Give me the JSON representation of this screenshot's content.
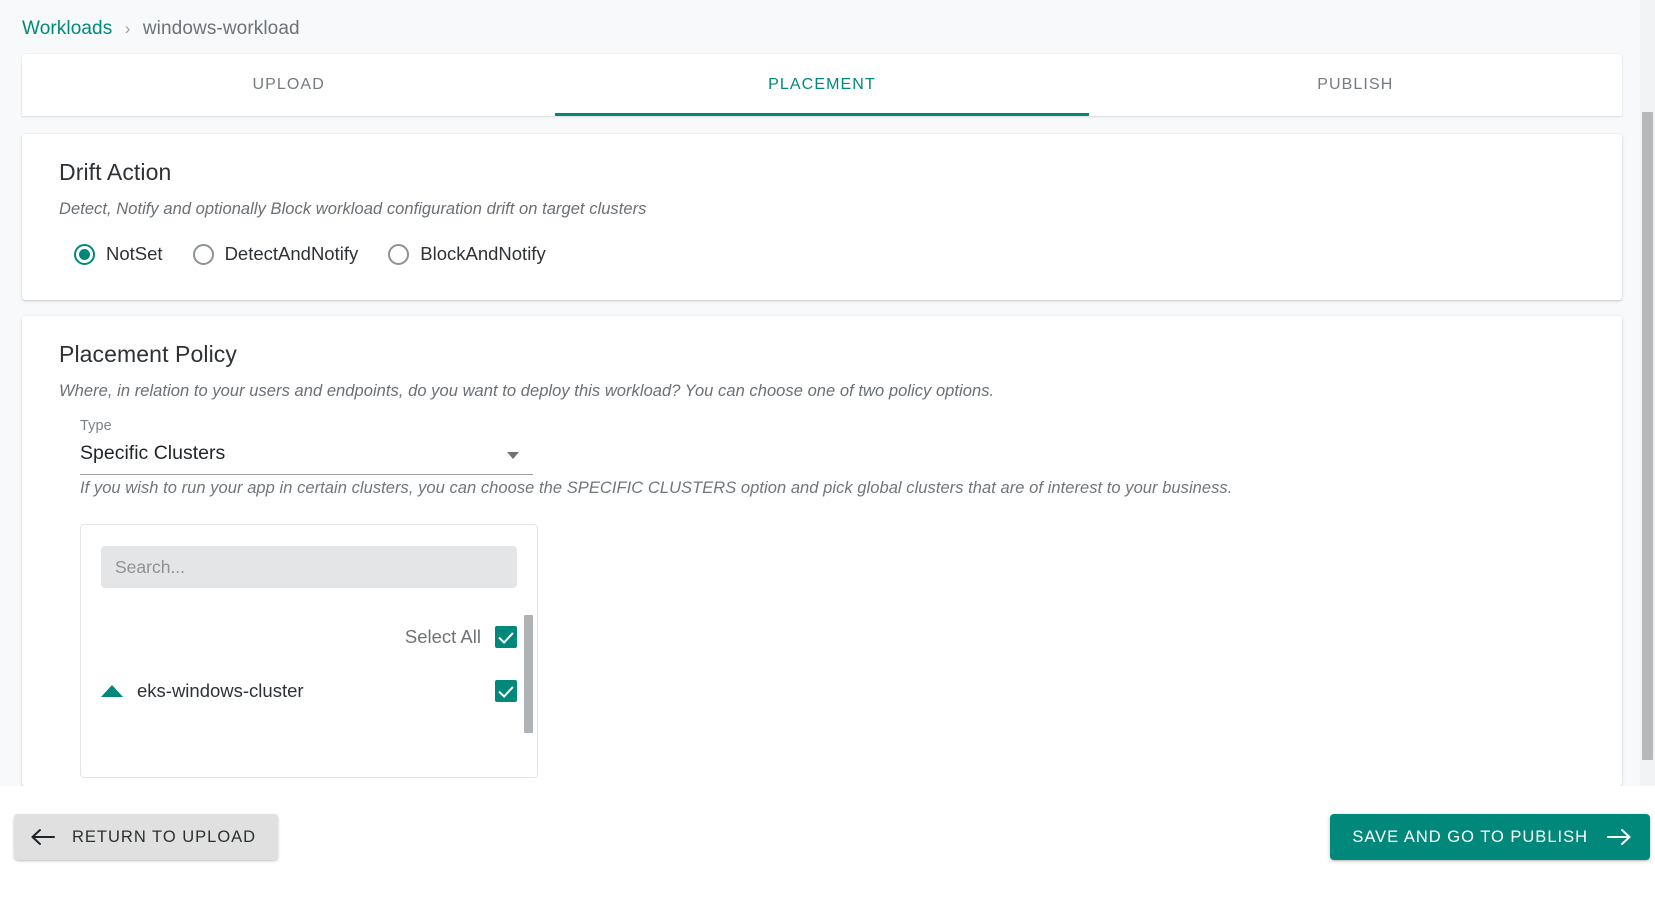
{
  "breadcrumb": {
    "root": "Workloads",
    "separator": "›",
    "current": "windows-workload"
  },
  "tabs": [
    {
      "label": "UPLOAD",
      "active": false
    },
    {
      "label": "PLACEMENT",
      "active": true
    },
    {
      "label": "PUBLISH",
      "active": false
    }
  ],
  "drift_action": {
    "title": "Drift Action",
    "description": "Detect, Notify and optionally Block workload configuration drift on target clusters",
    "options": [
      {
        "label": "NotSet",
        "checked": true
      },
      {
        "label": "DetectAndNotify",
        "checked": false
      },
      {
        "label": "BlockAndNotify",
        "checked": false
      }
    ]
  },
  "placement_policy": {
    "title": "Placement Policy",
    "description": "Where, in relation to your users and endpoints, do you want to deploy this workload? You can choose one of two policy options.",
    "type_field": {
      "label": "Type",
      "value": "Specific Clusters"
    },
    "help_text": "If you wish to run your app in certain clusters, you can choose the SPECIFIC CLUSTERS option and pick global clusters that are of interest to your business.",
    "picker": {
      "search_placeholder": "Search...",
      "search_value": "",
      "select_all_label": "Select All",
      "select_all_checked": true,
      "clusters": [
        {
          "name": "eks-windows-cluster",
          "checked": true,
          "expanded": true
        }
      ]
    }
  },
  "footer": {
    "back_label": "RETURN TO UPLOAD",
    "next_label": "SAVE AND GO TO PUBLISH"
  },
  "colors": {
    "accent": "#00897b",
    "page_background": "#f7f9fa",
    "card_background": "#ffffff",
    "muted_text": "#6d7377",
    "back_button": "#e0e0e0"
  }
}
